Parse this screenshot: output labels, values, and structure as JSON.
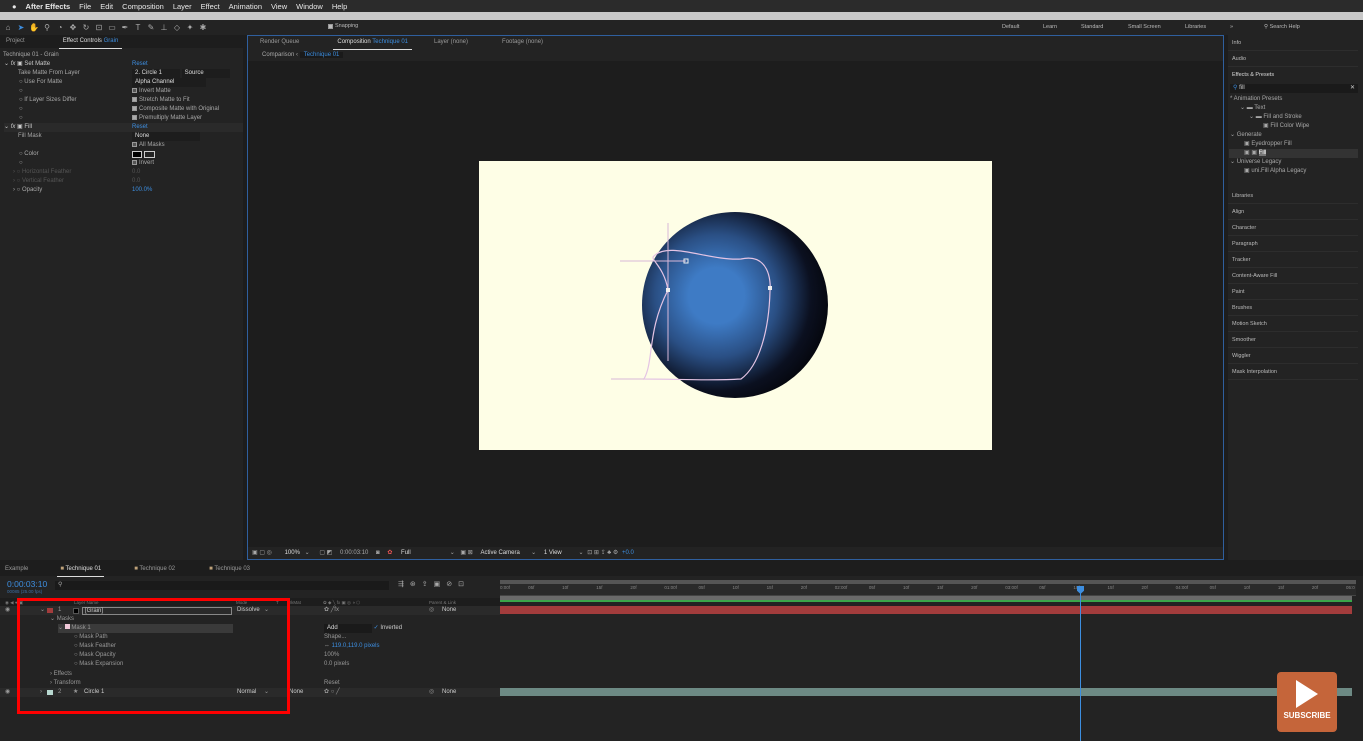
{
  "menubar": {
    "app": "After Effects",
    "items": [
      "File",
      "Edit",
      "Composition",
      "Layer",
      "Effect",
      "Animation",
      "View",
      "Window",
      "Help"
    ]
  },
  "toolbar": {
    "snapping": "Snapping",
    "workspaces": [
      "Default",
      "Learn",
      "Standard",
      "Small Screen",
      "Libraries"
    ],
    "search_help": "Search Help"
  },
  "left_panel": {
    "tab_project": "Project",
    "tab_effect_controls": "Effect Controls",
    "tab_layer": "Grain",
    "breadcrumb": "Technique 01 - Grain",
    "set_matte": {
      "name": "Set Matte",
      "reset": "Reset",
      "take_matte_label": "Take Matte From Layer",
      "take_matte_value": "2. Circle 1",
      "source": "Source",
      "use_for_matte_label": "Use For Matte",
      "use_for_matte_value": "Alpha Channel",
      "invert_matte": "Invert Matte",
      "if_sizes_label": "If Layer Sizes Differ",
      "stretch": "Stretch Matte to Fit",
      "composite": "Composite Matte with Original",
      "premultiply": "Premultiply Matte Layer"
    },
    "fill": {
      "name": "Fill",
      "reset": "Reset",
      "fill_mask_label": "Fill Mask",
      "fill_mask_value": "None",
      "all_masks": "All Masks",
      "color_label": "Color",
      "invert": "Invert",
      "hfeather_label": "Horizontal Feather",
      "hfeather": "0.0",
      "vfeather_label": "Vertical Feather",
      "vfeather": "0.0",
      "opacity_label": "Opacity",
      "opacity": "100.0%"
    }
  },
  "comp_panel": {
    "tab_render": "Render Queue",
    "tab_comp_prefix": "Composition",
    "tab_comp_name": "Technique 01",
    "tab_layer": "Layer (none)",
    "tab_footage": "Footage (none)",
    "comparison": "Comparison",
    "crumb": "Technique 01",
    "footer": {
      "zoom": "100%",
      "timecode": "0:00:03:10",
      "resolution": "Full",
      "camera": "Active Camera",
      "views": "1 View",
      "exposure": "+0.0"
    }
  },
  "right_panel": {
    "info": "Info",
    "audio": "Audio",
    "effects_presets": "Effects & Presets",
    "search": "fill",
    "tree": [
      "* Animation Presets",
      "Text",
      "Fill and Stroke",
      "Fill Color Wipe",
      "Generate",
      "Eyedropper Fill",
      "Fill",
      "Universe Legacy",
      "uni.Fill Alpha Legacy"
    ],
    "panels": [
      "Libraries",
      "Align",
      "Character",
      "Paragraph",
      "Tracker",
      "Content-Aware Fill",
      "Paint",
      "Brushes",
      "Motion Sketch",
      "Smoother",
      "Wiggler",
      "Mask Interpolation"
    ]
  },
  "timeline": {
    "tabs": [
      "Example",
      "Technique 01",
      "Technique 02",
      "Technique 03"
    ],
    "timecode": "0:00:03:10",
    "frames": "00085 (25.00 fps)",
    "headers": {
      "layer_name": "Layer Name",
      "mode": "Mode",
      "t": "T",
      "trkmat": "TrkMat",
      "parent": "Parent & Link"
    },
    "layer1": {
      "num": "1",
      "name": "[Grain]",
      "mode": "Dissolve",
      "parent": "None"
    },
    "masks": "Masks",
    "mask1": "Mask 1",
    "mask_mode": "Add",
    "inverted": "Inverted",
    "mask_props": [
      {
        "name": "Mask Path",
        "value": "Shape..."
      },
      {
        "name": "Mask Feather",
        "value": "119.0,119.0 pixels"
      },
      {
        "name": "Mask Opacity",
        "value": "100%"
      },
      {
        "name": "Mask Expansion",
        "value": "0.0 pixels"
      }
    ],
    "effects": "Effects",
    "transform": "Transform",
    "transform_reset": "Reset",
    "layer2": {
      "num": "2",
      "name": "Circle 1",
      "mode": "Normal",
      "trkmat": "None",
      "parent": "None"
    },
    "ruler": [
      "0:00f",
      "05f",
      "10f",
      "15f",
      "20f",
      "01:00f",
      "05f",
      "10f",
      "15f",
      "20f",
      "02:00f",
      "05f",
      "10f",
      "15f",
      "20f",
      "03:00f",
      "05f",
      "10f",
      "15f",
      "20f",
      "04:00f",
      "05f",
      "10f",
      "15f",
      "20f",
      "05:0"
    ]
  },
  "subscribe": "SUBSCRIBE",
  "colors": {
    "accent": "#3d8ee0",
    "canvas": "#fefee6",
    "highlight": "#ff0000",
    "layer_bar_red": "#a33c3c",
    "layer_bar_teal": "#6d8a84"
  }
}
